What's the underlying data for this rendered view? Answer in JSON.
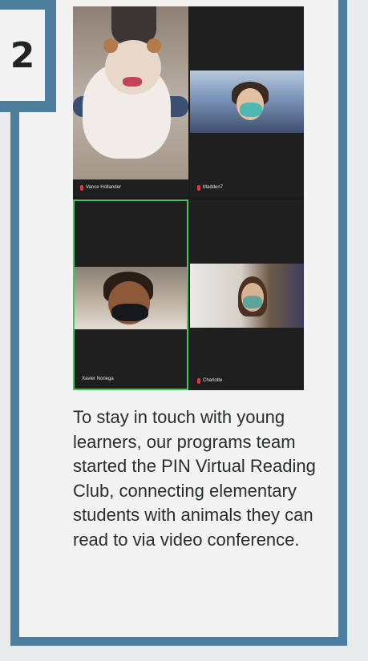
{
  "badge": {
    "number": "2"
  },
  "accent_color": "#4b7f9d",
  "video_call": {
    "participants": [
      {
        "name": "Vance Hollander",
        "muted": true,
        "active_speaker": false
      },
      {
        "name": "Madden7",
        "muted": true,
        "active_speaker": false
      },
      {
        "name": "Xavier Noriega",
        "muted": false,
        "active_speaker": true
      },
      {
        "name": "Charlotte",
        "muted": true,
        "active_speaker": false
      }
    ],
    "active_speaker_color": "#46c45f",
    "muted_icon_color": "#e0383f"
  },
  "caption": {
    "text": "To stay in touch with young learners, our programs team started the PIN Virtual Reading Club, connecting elementary students with animals they can read to via video conference."
  }
}
